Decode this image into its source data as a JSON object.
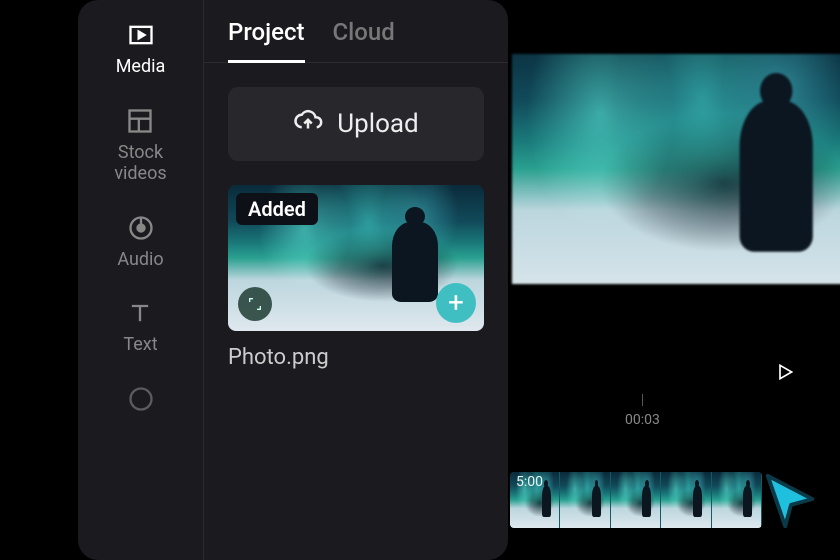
{
  "sidebar": {
    "items": [
      {
        "label": "Media"
      },
      {
        "label": "Stock\nvideos"
      },
      {
        "label": "Audio"
      },
      {
        "label": "Text"
      }
    ]
  },
  "tabs": {
    "project": "Project",
    "cloud": "Cloud"
  },
  "upload": {
    "label": "Upload"
  },
  "media": {
    "badge": "Added",
    "filename": "Photo.png"
  },
  "timeline": {
    "tick": "00:03",
    "clip_duration": "5:00"
  },
  "icons": {
    "media": "media-icon",
    "stock": "stock-videos-icon",
    "audio": "audio-icon",
    "text": "text-icon"
  },
  "colors": {
    "accent": "#3fbfc2",
    "cursor": "#1fc0de"
  }
}
